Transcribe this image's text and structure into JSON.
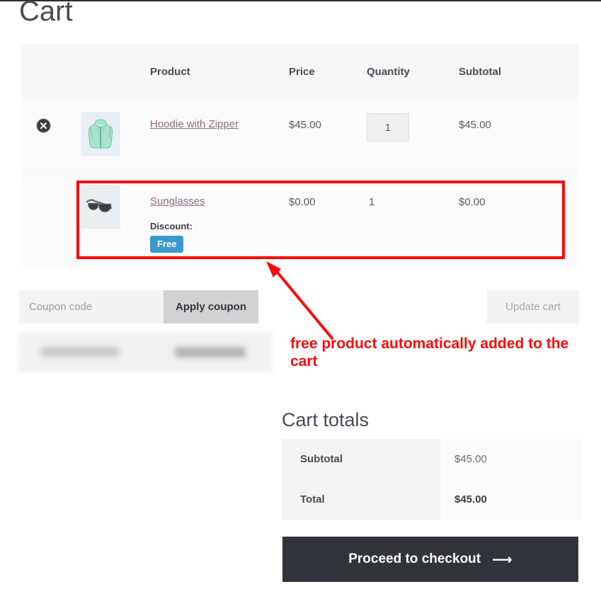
{
  "page": {
    "title": "Cart"
  },
  "cart_table": {
    "columns": [
      "",
      "",
      "Product",
      "Price",
      "Quantity",
      "Subtotal"
    ],
    "headers": {
      "product": "Product",
      "price": "Price",
      "quantity": "Quantity",
      "subtotal": "Subtotal"
    },
    "rows": [
      {
        "remove_icon": "remove-circle-icon",
        "thumbnail_icon": "hoodie-thumbnail",
        "name": "Hoodie with Zipper",
        "price": "$45.00",
        "quantity": "1",
        "subtotal": "$45.00",
        "removable": true,
        "quantity_editable": true
      },
      {
        "remove_icon": "",
        "thumbnail_icon": "sunglasses-thumbnail",
        "name": "Sunglasses",
        "price": "$0.00",
        "quantity": "1",
        "subtotal": "$0.00",
        "removable": false,
        "quantity_editable": false,
        "discount_label": "Discount:",
        "discount_badge": "Free"
      }
    ]
  },
  "coupon": {
    "placeholder": "Coupon code",
    "value": "",
    "apply_label": "Apply coupon",
    "update_label": "Update cart"
  },
  "totals": {
    "title": "Cart totals",
    "rows": [
      {
        "label": "Subtotal",
        "value": "$45.00"
      },
      {
        "label": "Total",
        "value": "$45.00"
      }
    ],
    "checkout_label": "Proceed to checkout",
    "checkout_arrow": "⟶"
  },
  "annotation": {
    "text": "free product automatically added to the cart",
    "color": "#fb0b0b"
  },
  "colors": {
    "badge_blue": "#3d98cd",
    "annotation_red": "#fb0b0b",
    "link_purple": "#8c6d82",
    "checkout_dark": "#33333a",
    "header_gray": "#f7f7f7"
  }
}
